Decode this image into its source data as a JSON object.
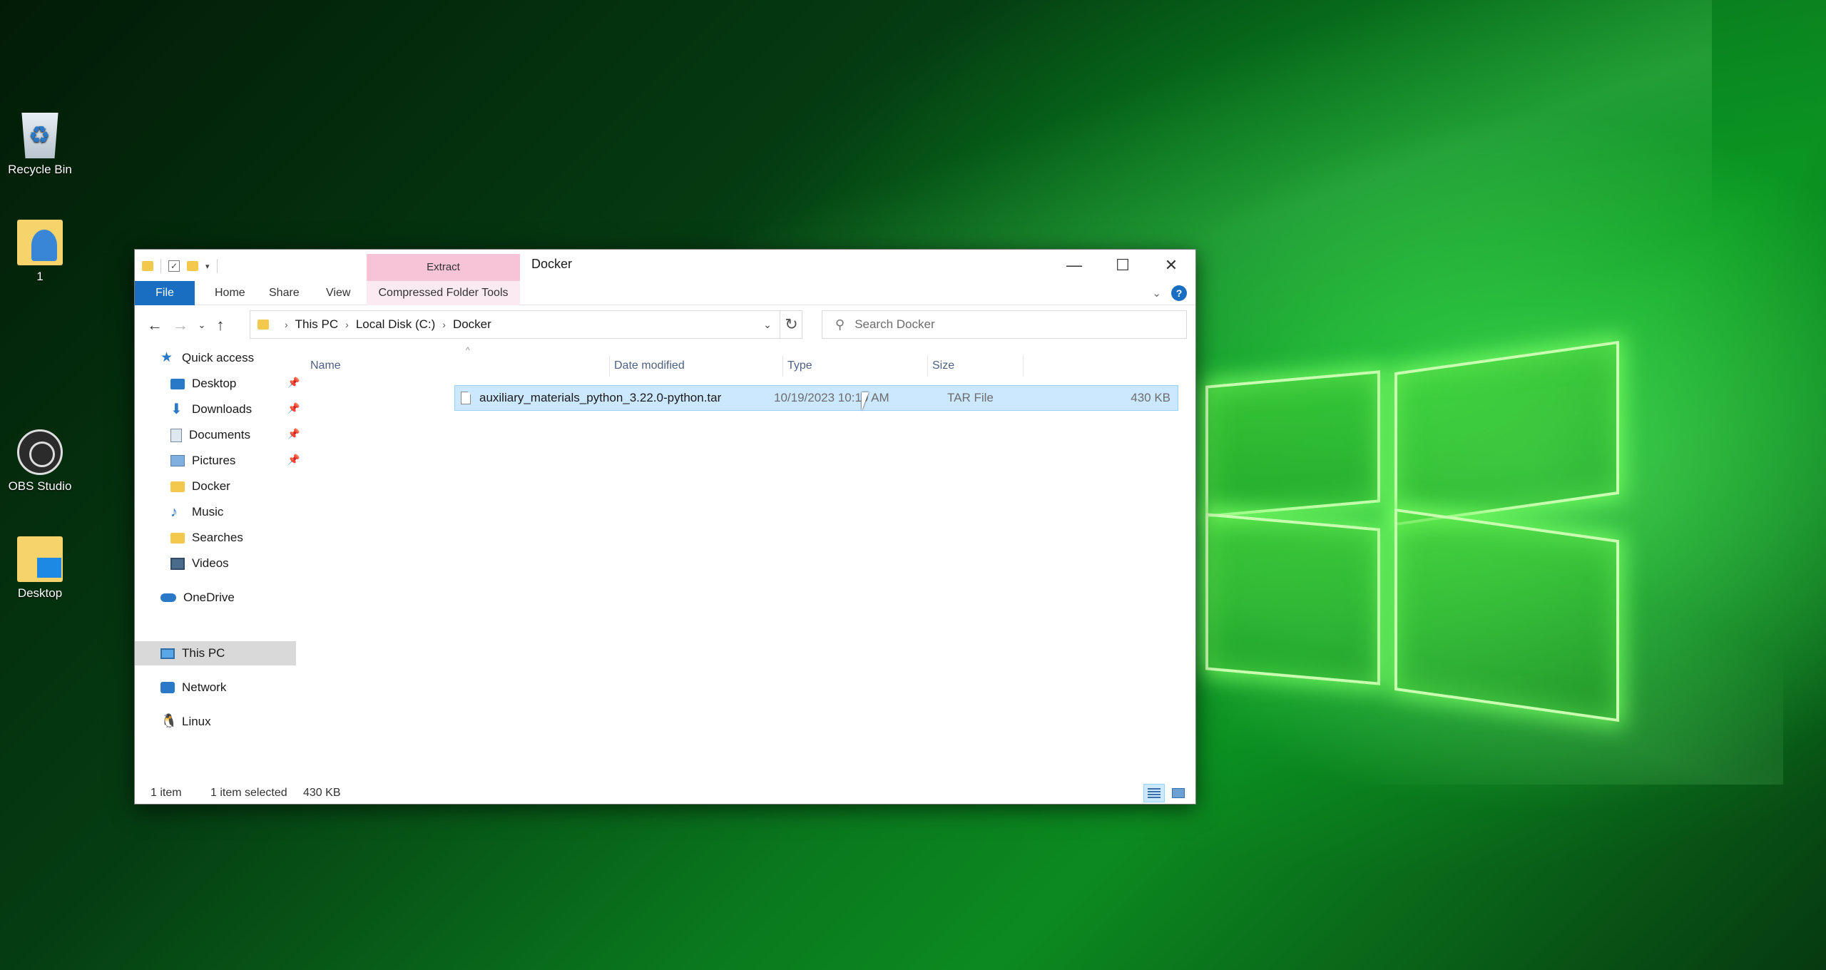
{
  "desktop": {
    "icons": [
      {
        "label": "Recycle Bin",
        "icon": "recycle-bin-icon"
      },
      {
        "label": "1",
        "icon": "image-folder-icon"
      },
      {
        "label": "OBS Studio",
        "icon": "obs-studio-icon"
      },
      {
        "label": "Desktop",
        "icon": "desktop-folder-icon"
      }
    ]
  },
  "window": {
    "title": "Docker",
    "context_tab_label": "Extract",
    "controls": {
      "minimize": "—",
      "maximize": "☐",
      "close": "✕"
    }
  },
  "ribbon": {
    "tabs": [
      "File",
      "Home",
      "Share",
      "View",
      "Compressed Folder Tools"
    ],
    "help": "?"
  },
  "address": {
    "crumbs": [
      "This PC",
      "Local Disk (C:)",
      "Docker"
    ]
  },
  "search": {
    "placeholder": "Search Docker"
  },
  "nav_pane": {
    "quick_access": "Quick access",
    "quick_items": [
      {
        "label": "Desktop",
        "pinned": true
      },
      {
        "label": "Downloads",
        "pinned": true
      },
      {
        "label": "Documents",
        "pinned": true
      },
      {
        "label": "Pictures",
        "pinned": true
      },
      {
        "label": "Docker",
        "pinned": false
      },
      {
        "label": "Music",
        "pinned": false
      },
      {
        "label": "Searches",
        "pinned": false
      },
      {
        "label": "Videos",
        "pinned": false
      }
    ],
    "roots": [
      "OneDrive",
      "This PC",
      "Network",
      "Linux"
    ]
  },
  "columns": [
    "Name",
    "Date modified",
    "Type",
    "Size"
  ],
  "files": [
    {
      "name": "auxiliary_materials_python_3.22.0-python.tar",
      "date_modified": "10/19/2023 10:19 AM",
      "type": "TAR File",
      "size": "430 KB",
      "selected": true
    }
  ],
  "status": {
    "count": "1 item",
    "selection": "1 item selected",
    "selection_size": "430 KB"
  },
  "colors": {
    "accent": "#1a6ec1",
    "selection_bg": "#cce8ff",
    "context_tab": "#f7c3d6"
  }
}
